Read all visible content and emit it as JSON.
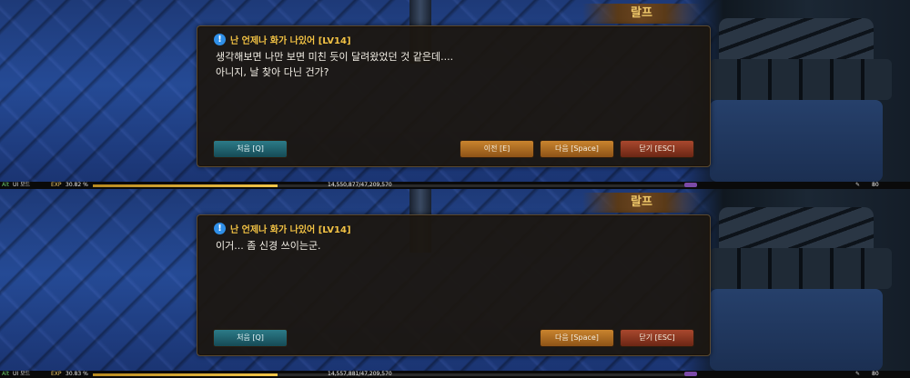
{
  "frames": [
    {
      "npc_name": "랄프",
      "quest": {
        "title": "난 언제나 화가 나있어 [LV14]"
      },
      "lines": [
        "생각해보면 나만 보면 미친 듯이 달려왔었던 것 같은데....",
        "아니지, 날 찾아 다닌 건가?"
      ],
      "buttons": {
        "first": "처음 [Q]",
        "prev": "이전 [E]",
        "next": "다음 [Space]",
        "close": "닫기 [ESC]"
      },
      "status": {
        "alt": "Alt",
        "ui_mode": "UI 모드",
        "exp_label": "EXP",
        "exp_pct": "30.82 %",
        "exp_progress": 0.3082,
        "exp_value": "14,550,877/47,209,570",
        "level": "80"
      }
    },
    {
      "npc_name": "랄프",
      "quest": {
        "title": "난 언제나 화가 나있어 [LV14]"
      },
      "lines": [
        "이거... 좀 신경 쓰이는군."
      ],
      "buttons": {
        "first": "처음 [Q]",
        "next": "다음 [Space]",
        "close": "닫기 [ESC]"
      },
      "status": {
        "alt": "Alt",
        "ui_mode": "UI 모드",
        "exp_label": "EXP",
        "exp_pct": "30.83 %",
        "exp_progress": 0.3083,
        "exp_value": "14,557,881/47,209,570",
        "level": "80"
      }
    }
  ],
  "colors": {
    "quest_title": "#f2c244",
    "npc_name": "#f0c96a",
    "exp_fill": "#f3c64a"
  },
  "icons": {
    "quest": "info-circle-icon"
  }
}
